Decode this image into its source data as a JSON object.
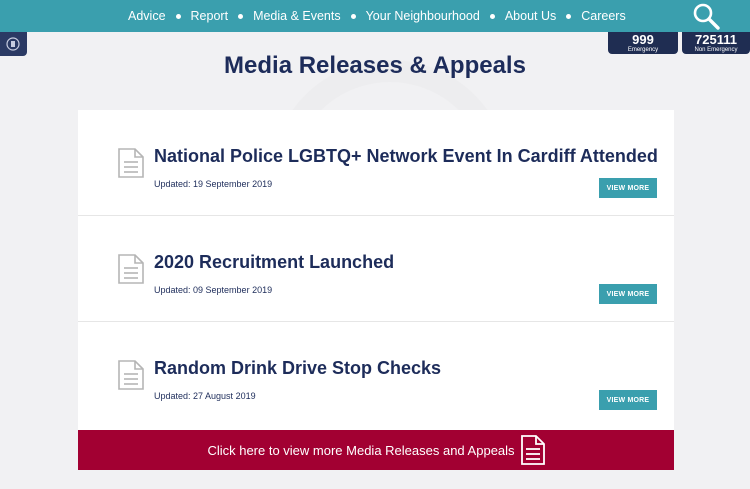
{
  "nav": {
    "items": [
      "Advice",
      "Report",
      "Media & Events",
      "Your Neighbourhood",
      "About Us",
      "Careers"
    ]
  },
  "contacts": [
    {
      "number": "999",
      "label": "Emergency"
    },
    {
      "number": "725111",
      "label": "Non Emergency"
    }
  ],
  "page": {
    "title": "Media Releases & Appeals"
  },
  "releases": [
    {
      "title": "National Police LGBTQ+ Network Event In Cardiff Attended",
      "date": "Updated: 19 September 2019",
      "button": "VIEW MORE"
    },
    {
      "title": "2020 Recruitment Launched",
      "date": "Updated: 09 September 2019",
      "button": "VIEW MORE"
    },
    {
      "title": "Random Drink Drive Stop Checks",
      "date": "Updated: 27 August 2019",
      "button": "VIEW MORE"
    }
  ],
  "banner": {
    "text": "Click here to view more Media Releases and Appeals"
  },
  "colors": {
    "nav": "#3a9fae",
    "navy": "#1d2c5a",
    "banner": "#a20032"
  },
  "icons": {
    "search": "search-icon",
    "document": "document-icon"
  }
}
